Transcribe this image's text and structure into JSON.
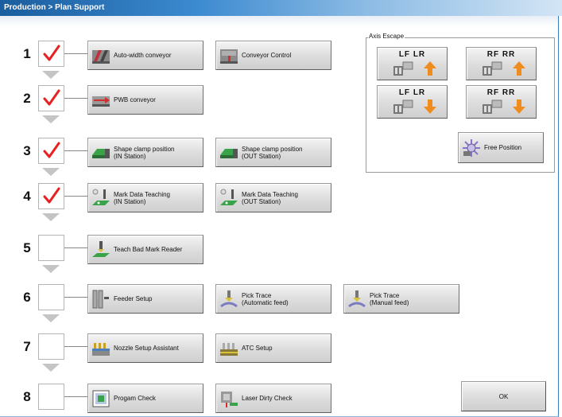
{
  "title": "Production > Plan Support",
  "accent_color": "#1a5d9e",
  "check_color": "#e82020",
  "steps": [
    {
      "number": "1",
      "checked": true,
      "buttons": [
        {
          "label": "Auto-width conveyor",
          "icon": "conveyor-width-icon"
        },
        {
          "label": "Conveyor Control",
          "icon": "conveyor-control-icon"
        }
      ]
    },
    {
      "number": "2",
      "checked": true,
      "buttons": [
        {
          "label": "PWB conveyor",
          "icon": "pwb-conveyor-icon"
        }
      ]
    },
    {
      "number": "3",
      "checked": true,
      "buttons": [
        {
          "label": "Shape clamp position\n(IN Station)",
          "icon": "shape-clamp-icon"
        },
        {
          "label": "Shape clamp position\n(OUT Station)",
          "icon": "shape-clamp-icon"
        }
      ]
    },
    {
      "number": "4",
      "checked": true,
      "buttons": [
        {
          "label": "Mark Data Teaching\n(IN Station)",
          "icon": "mark-teaching-icon"
        },
        {
          "label": "Mark Data Teaching\n(OUT Station)",
          "icon": "mark-teaching-icon"
        }
      ]
    },
    {
      "number": "5",
      "checked": false,
      "buttons": [
        {
          "label": "Teach Bad Mark Reader",
          "icon": "bad-mark-reader-icon"
        }
      ]
    },
    {
      "number": "6",
      "checked": false,
      "buttons": [
        {
          "label": "Feeder Setup",
          "icon": "feeder-icon"
        },
        {
          "label": "Pick Trace\n(Automatic feed)",
          "icon": "pick-trace-icon"
        },
        {
          "label": "Pick Trace\n(Manual feed)",
          "icon": "pick-trace-icon"
        }
      ]
    },
    {
      "number": "7",
      "checked": false,
      "buttons": [
        {
          "label": "Nozzle Setup Assistant",
          "icon": "nozzle-icon"
        },
        {
          "label": "ATC Setup",
          "icon": "atc-icon"
        }
      ]
    },
    {
      "number": "8",
      "checked": false,
      "buttons": [
        {
          "label": "Progam Check",
          "icon": "program-check-icon"
        },
        {
          "label": "Laser Dirty Check",
          "icon": "laser-check-icon"
        }
      ]
    }
  ],
  "axis_escape": {
    "legend": "Axis Escape",
    "buttons": [
      {
        "label": "LF  LR",
        "direction": "up"
      },
      {
        "label": "RF  RR",
        "direction": "up"
      },
      {
        "label": "LF  LR",
        "direction": "down"
      },
      {
        "label": "RF  RR",
        "direction": "down"
      }
    ],
    "free_position_label": "Free Position",
    "arrow_color": "#f08c1e"
  },
  "ok_label": "OK"
}
